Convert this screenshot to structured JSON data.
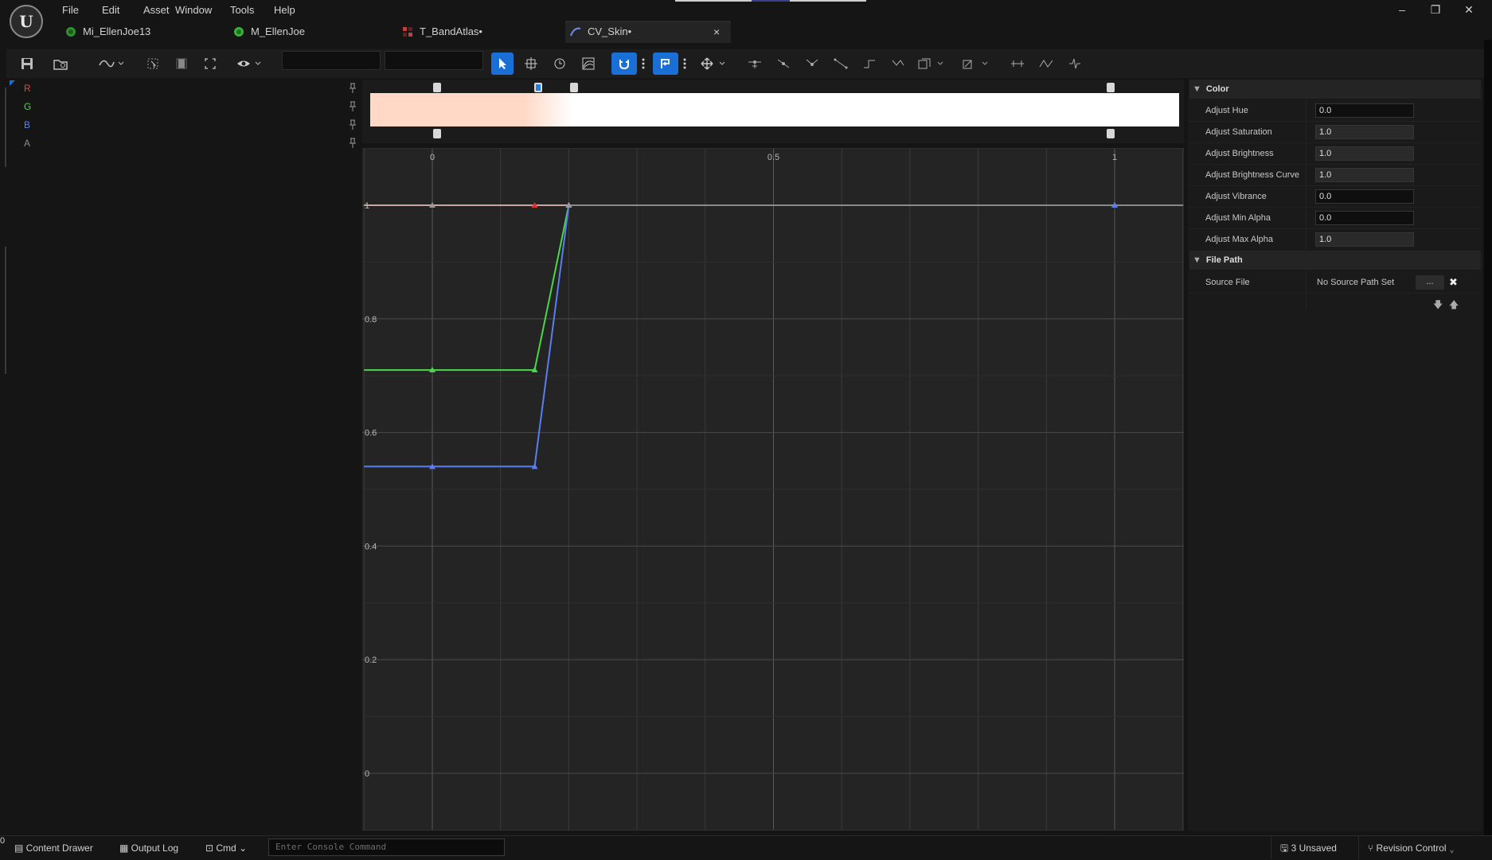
{
  "menu": [
    "File",
    "Edit",
    "Asset",
    "Window",
    "Tools",
    "Help"
  ],
  "window_controls": {
    "minimize": "–",
    "maximize": "❐",
    "close": "✕"
  },
  "tabs": [
    {
      "label": "Mi_EllenJoe13",
      "icon": "material-instance-icon"
    },
    {
      "label": "M_EllenJoe",
      "icon": "material-icon"
    },
    {
      "label": "T_BandAtlas•",
      "icon": "texture-icon"
    },
    {
      "label": "CV_Skin•",
      "icon": "curve-icon",
      "active": true
    }
  ],
  "tab_close": "×",
  "toolbar": {
    "icons": [
      "save-icon",
      "browse-icon",
      "curve-mode-icon",
      "select-icon",
      "frame-icon",
      "fit-icon",
      "visibility-icon",
      "pointer-icon",
      "transform-icon",
      "retime-icon",
      "multi-curve-icon",
      "snap-icon",
      "more-icon",
      "snap-value-icon",
      "more-icon",
      "move-icon",
      "tangent-auto-icon",
      "tangent-user-icon",
      "tangent-break-icon",
      "tangent-linear-icon",
      "tangent-constant-icon",
      "tangent-weighted-icon",
      "flatten-icon",
      "straighten-icon",
      "distribute-icon",
      "reduce-icon",
      "filter-icon"
    ]
  },
  "channels": [
    {
      "label": "R",
      "color": "#e04848"
    },
    {
      "label": "G",
      "color": "#48d848"
    },
    {
      "label": "B",
      "color": "#5a7ef0"
    },
    {
      "label": "A",
      "color": "#8a8a8a"
    }
  ],
  "gradient_stops_top": [
    0.0,
    0.15,
    0.2,
    1.0
  ],
  "gradient_stops_bottom": [
    0.0,
    1.0
  ],
  "chart_data": {
    "type": "line",
    "x_ticks": [
      "0",
      "0.5",
      "1"
    ],
    "y_ticks": [
      "1",
      "0.8",
      "0.6",
      "0.4",
      "0.2",
      "0"
    ],
    "xlim": [
      -0.1,
      1.1
    ],
    "ylim": [
      -0.1,
      1.1
    ],
    "series": [
      {
        "name": "R",
        "color": "#c8a8a0",
        "x": [
          -0.1,
          0.0,
          0.15,
          0.2,
          1.0,
          1.1
        ],
        "y": [
          1,
          1,
          1,
          1,
          1,
          1
        ]
      },
      {
        "name": "G",
        "color": "#48d848",
        "x": [
          -0.1,
          0.0,
          0.15,
          0.2,
          1.0,
          1.1
        ],
        "y": [
          0.71,
          0.71,
          0.71,
          1,
          1,
          1
        ]
      },
      {
        "name": "B",
        "color": "#5a7ef0",
        "x": [
          -0.1,
          0.0,
          0.15,
          0.2,
          1.0,
          1.1
        ],
        "y": [
          0.54,
          0.54,
          0.54,
          1,
          1,
          1
        ]
      },
      {
        "name": "A",
        "color": "#8a8a8a",
        "x": [
          0.2,
          1.1
        ],
        "y": [
          1,
          1
        ]
      }
    ]
  },
  "details": {
    "category_color": "Color",
    "properties": [
      {
        "label": "Adjust Hue",
        "value": "0.0"
      },
      {
        "label": "Adjust Saturation",
        "value": "1.0"
      },
      {
        "label": "Adjust Brightness",
        "value": "1.0"
      },
      {
        "label": "Adjust Brightness Curve",
        "value": "1.0"
      },
      {
        "label": "Adjust Vibrance",
        "value": "0.0"
      },
      {
        "label": "Adjust Min Alpha",
        "value": "0.0"
      },
      {
        "label": "Adjust Max Alpha",
        "value": "1.0"
      }
    ],
    "category_filepath": "File Path",
    "source_file_label": "Source File",
    "source_file_value": "No Source Path Set",
    "browse_label": "...",
    "clear_label": "✖"
  },
  "statusbar": {
    "content_drawer": "Content Drawer",
    "output_log": "Output Log",
    "cmd": "Cmd",
    "console_placeholder": "Enter Console Command",
    "unsaved": "3 Unsaved",
    "revision_control": "Revision Control",
    "corner_digit": "0"
  }
}
